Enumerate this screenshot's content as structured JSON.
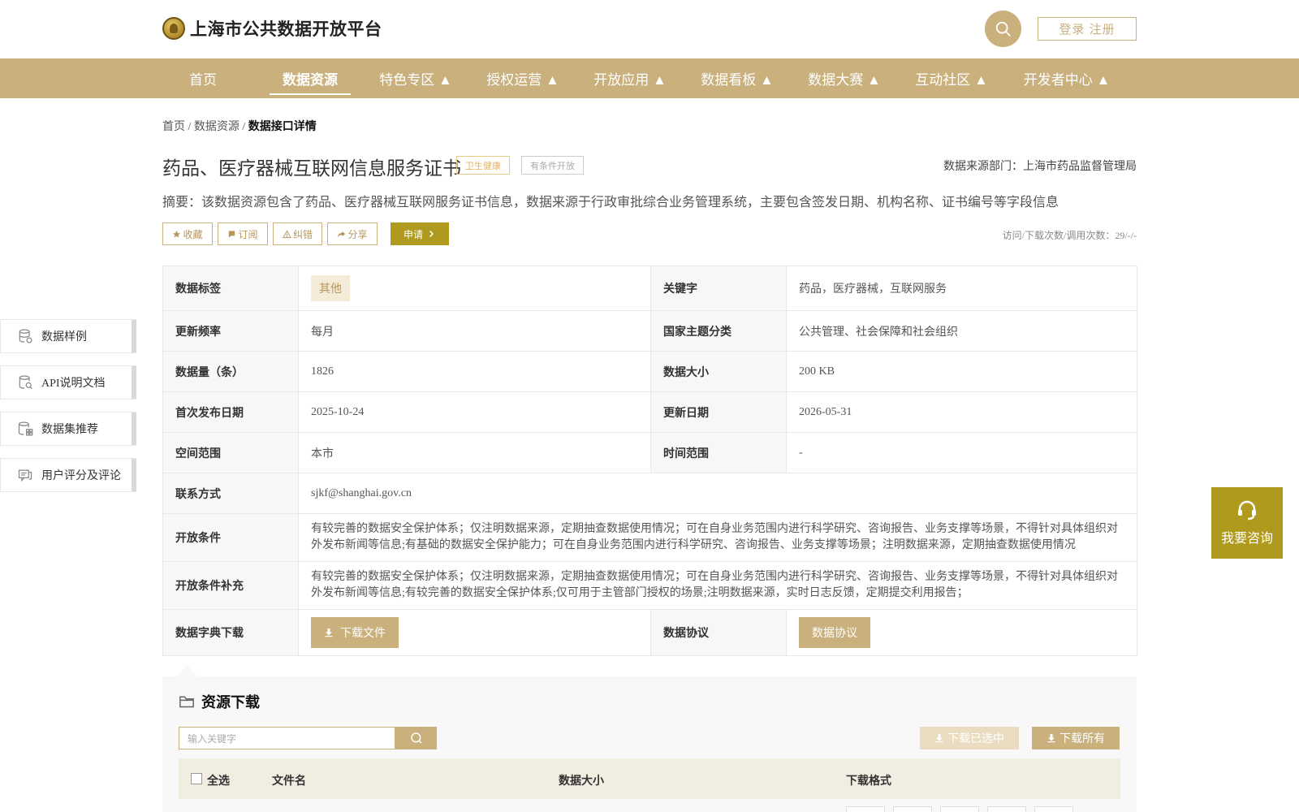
{
  "header": {
    "site_title": "上海市公共数据开放平台",
    "login_label": "登录 注册"
  },
  "nav": [
    {
      "label": "首页"
    },
    {
      "label": "数据资源"
    },
    {
      "label": "特色专区 ▲"
    },
    {
      "label": "授权运营 ▲"
    },
    {
      "label": "开放应用 ▲"
    },
    {
      "label": "数据看板 ▲"
    },
    {
      "label": "数据大赛 ▲"
    },
    {
      "label": "互动社区 ▲"
    },
    {
      "label": "开发者中心 ▲"
    }
  ],
  "breadcrumb": {
    "home": "首页",
    "resources": "数据资源",
    "current": "数据接口详情",
    "separator": "/"
  },
  "resource": {
    "title": "药品、医疗器械互联网信息服务证书",
    "tag_category": "卫生健康",
    "tag_open": "有条件开放",
    "source_dept": "数据来源部门：上海市药品监督管理局",
    "summary": "摘要：该数据资源包含了药品、医疗器械互联网服务证书信息，数据来源于行政审批综合业务管理系统，主要包含签发日期、机构名称、证书编号等字段信息",
    "visits": "访问/下载次数/调用次数：29/-/-"
  },
  "actions": {
    "favorite": "收藏",
    "subscribe": "订阅",
    "correct": "纠错",
    "share": "分享",
    "apply": "申请"
  },
  "details": {
    "data_tag_label": "数据标签",
    "data_tag_value": "其他",
    "keywords_label": "关键字",
    "keywords_value": "药品，医疗器械，互联网服务",
    "frequency_label": "更新频率",
    "frequency_value": "每月",
    "theme_label": "国家主题分类",
    "theme_value": "公共管理、社会保障和社会组织",
    "count_label": "数据量（条）",
    "count_value": "1826",
    "size_label": "数据大小",
    "size_value": "200 KB",
    "first_pub_label": "首次发布日期",
    "first_pub_value": "2025-10-24",
    "update_label": "更新日期",
    "update_value": "2026-05-31",
    "space_label": "空间范围",
    "space_value": "本市",
    "time_label": "时间范围",
    "time_value": "-",
    "contact_label": "联系方式",
    "contact_value": "sjkf@shanghai.gov.cn",
    "cond_label": "开放条件",
    "cond_value": "有较完善的数据安全保护体系；仅注明数据来源，定期抽查数据使用情况；可在自身业务范围内进行科学研究、咨询报告、业务支撑等场景，不得针对具体组织对外发布新闻等信息;有基础的数据安全保护能力；可在自身业务范围内进行科学研究、咨询报告、业务支撑等场景；注明数据来源，定期抽查数据使用情况",
    "cond_extra_label": "开放条件补充",
    "cond_extra_value": "有较完善的数据安全保护体系；仅注明数据来源，定期抽查数据使用情况；可在自身业务范围内进行科学研究、咨询报告、业务支撑等场景，不得针对具体组织对外发布新闻等信息;有较完善的数据安全保护体系;仅可用于主管部门授权的场景;注明数据来源，实时日志反馈，定期提交利用报告；",
    "dict_label": "数据字典下载",
    "dict_button": "下载文件",
    "agreement_label": "数据协议",
    "agreement_button": "数据协议"
  },
  "sidebar": [
    {
      "label": "数据样例",
      "icon": "database-icon"
    },
    {
      "label": "API说明文档",
      "icon": "doc-search-icon"
    },
    {
      "label": "数据集推荐",
      "icon": "dataset-grid-icon"
    },
    {
      "label": "用户评分及评论",
      "icon": "comment-icon"
    }
  ],
  "consult": {
    "label": "我要咨询"
  },
  "download": {
    "title": "资源下载",
    "keyword_placeholder": "输入关键字",
    "download_selected": "下载已选中",
    "download_all": "下载所有",
    "col_select_all": "全选",
    "col_filename": "文件名",
    "col_size": "数据大小",
    "col_format": "下载格式"
  },
  "colors": {
    "brand_gold": "#c9b07c",
    "accent_olive": "#b09a1e"
  }
}
